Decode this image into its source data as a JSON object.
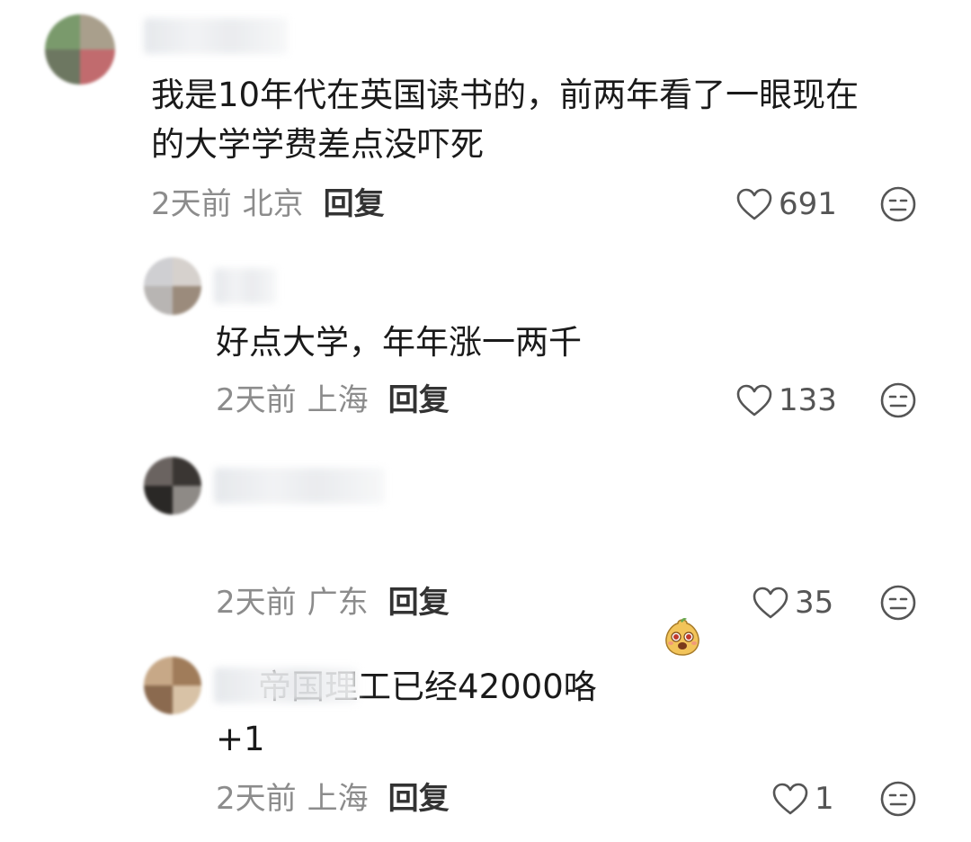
{
  "comments": [
    {
      "text": "我是10年代在英国读书的，前两年看了一眼现在\n的大学学费差点没吓死",
      "time": "2天前",
      "location": "北京",
      "reply_label": "回复",
      "likes": "691",
      "avatar_colors": [
        "#7a9a6c",
        "#a99f8c",
        "#c16b6e",
        "#6d7761"
      ]
    },
    {
      "text": "好点大学，年年涨一两千",
      "time": "2天前",
      "location": "上海",
      "reply_label": "回复",
      "likes": "133",
      "avatar_colors": [
        "#cfcfd2",
        "#9b8b7c",
        "#b8b5b3",
        "#d6d1cd"
      ]
    },
    {
      "text": "帝国理工已经42000咯",
      "time": "2天前",
      "location": "广东",
      "reply_label": "回复",
      "likes": "35",
      "avatar_colors": [
        "#3a3633",
        "#6a6360",
        "#2a2826",
        "#8e8a86"
      ]
    },
    {
      "text": "+1",
      "time": "2天前",
      "location": "上海",
      "reply_label": "回复",
      "likes": "1",
      "avatar_colors": [
        "#a07c5a",
        "#c7a887",
        "#8b6a4f",
        "#d8c2a6"
      ]
    }
  ],
  "icons": {
    "like": "heart-icon",
    "reaction": "neutral-face-icon",
    "emoji": "cartoon-emoji-icon"
  },
  "colors": {
    "text": "#1a1a1a",
    "meta": "#8c8c8c",
    "reply": "#333333",
    "icon": "#555555"
  }
}
